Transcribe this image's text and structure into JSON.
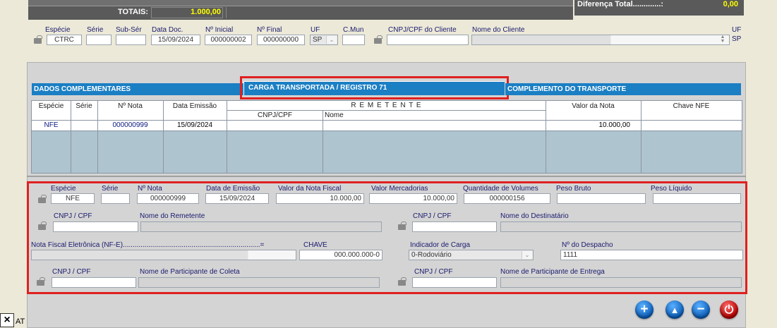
{
  "totals": {
    "label": "TOTAIS:",
    "value": "1.000,00",
    "diferenca_label": "Diferença Total.............:",
    "diferenca_value": "0,00"
  },
  "doc_row": {
    "especie_label": "Espécie",
    "especie_value": "CTRC",
    "serie_label": "Série",
    "serie_value": "",
    "subserie_label": "Sub-Sér",
    "subserie_value": "",
    "data_doc_label": "Data Doc.",
    "data_doc_value": "15/09/2024",
    "n_inicial_label": "Nº Inicial",
    "n_inicial_value": "000000002",
    "n_final_label": "Nº Final",
    "n_final_value": "000000000",
    "uf_label": "UF",
    "uf_value": "SP",
    "cmun_label": "C.Mun",
    "cmun_value": "",
    "cnpj_cliente_label": "CNPJ/CPF do Cliente",
    "cnpj_cliente_value": "",
    "nome_cliente_label": "Nome do Cliente",
    "nome_cliente_value": "",
    "uf_right_label_1": "UF",
    "uf_right_label_2": "SP"
  },
  "tabs": [
    {
      "label": "DADOS COMPLEMENTARES"
    },
    {
      "label": "CARGA TRANSPORTADA / REGISTRO 71"
    },
    {
      "label": "COMPLEMENTO DO TRANSPORTE"
    }
  ],
  "grid": {
    "headers": {
      "especie": "Espécie",
      "serie": "Série",
      "n_nota": "Nº Nota",
      "data_emissao": "Data Emissão",
      "remetente": "R E M E T E N T E",
      "cnpj": "CNPJ/CPF",
      "nome": "Nome",
      "valor": "Valor da Nota",
      "chave": "Chave NFE"
    },
    "rows": [
      {
        "especie": "NFE",
        "serie": "",
        "n_nota": "000000999",
        "data_emissao": "15/09/2024",
        "cnpj": "",
        "nome": "",
        "valor": "10.000,00",
        "chave": ""
      }
    ]
  },
  "detail": {
    "especie_label": "Espécie",
    "especie_value": "NFE",
    "serie_label": "Série",
    "serie_value": "",
    "n_nota_label": "Nº Nota",
    "n_nota_value": "000000999",
    "data_emissao_label": "Data de Emissão",
    "data_emissao_value": "15/09/2024",
    "valor_nf_label": "Valor da Nota Fiscal",
    "valor_nf_value": "10.000,00",
    "valor_merc_label": "Valor Mercadorias",
    "valor_merc_value": "10.000,00",
    "qtd_vol_label": "Quantidade de Volumes",
    "qtd_vol_value": "000000156",
    "peso_bruto_label": "Peso Bruto",
    "peso_bruto_value": "",
    "peso_liq_label": "Peso Líquido",
    "peso_liq_value": "",
    "cnpj_rem_label": "CNPJ / CPF",
    "cnpj_rem_value": "",
    "nome_rem_label": "Nome do Remetente",
    "nome_rem_value": "",
    "cnpj_dest_label": "CNPJ / CPF",
    "cnpj_dest_value": "",
    "nome_dest_label": "Nome do Destinatário",
    "nome_dest_value": "",
    "nfe_label": "Nota Fiscal Eletrônica (NF-E)......................................................................=",
    "chave_label": "CHAVE",
    "chave_value": "000.000.000-0",
    "ind_carga_label": "Indicador de Carga",
    "ind_carga_value": "0-Rodoviário",
    "despacho_label": "Nº do Despacho",
    "despacho_value": "1111",
    "cnpj_coleta_label": "CNPJ / CPF",
    "cnpj_coleta_value": "",
    "nome_coleta_label": "Nome de Participante de Coleta",
    "nome_coleta_value": "",
    "cnpj_entrega_label": "CNPJ / CPF",
    "cnpj_entrega_value": "",
    "nome_entrega_label": "Nome de Participante de Entrega",
    "nome_entrega_value": ""
  },
  "taskbar": {
    "close_glyph": "×",
    "label": "AT"
  },
  "colors": {
    "tab_blue": "#1b7fc4",
    "grid_bg": "#aec4cf",
    "highlight_red": "#e02020",
    "header_dark": "#4a4a4a",
    "totals_yellow": "#ffff00"
  }
}
